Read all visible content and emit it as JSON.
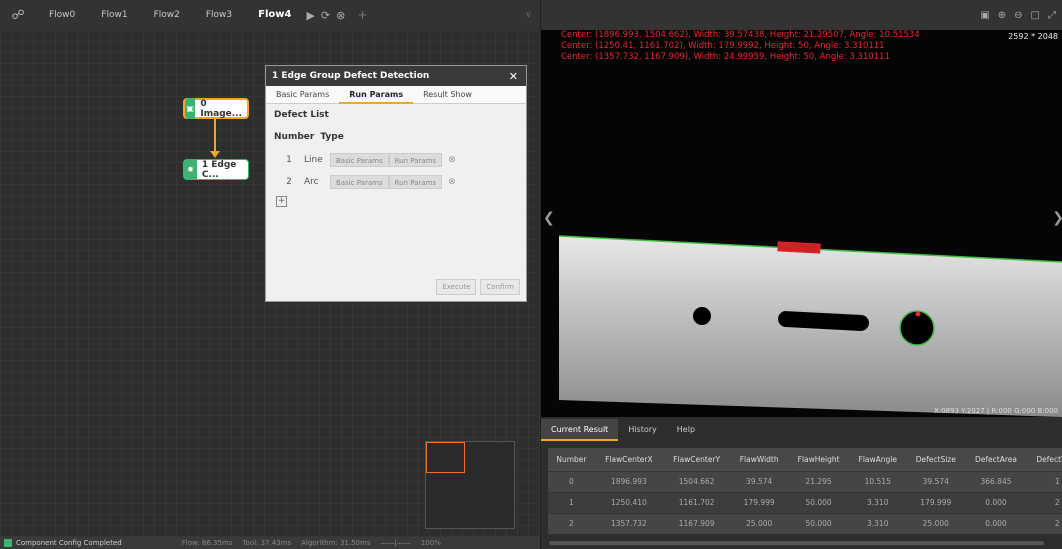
{
  "flow_tabs": [
    "Flow0",
    "Flow1",
    "Flow2",
    "Flow3",
    "Flow4"
  ],
  "active_flow": "Flow4",
  "nodes": [
    {
      "label": "0 Image..."
    },
    {
      "label": "1 Edge C..."
    }
  ],
  "dialog": {
    "title": "1  Edge Group Defect Detection",
    "tabs": [
      "Basic Params",
      "Run Params",
      "Result Show"
    ],
    "active_tab": "Run Params",
    "section": "Defect List",
    "col_number": "Number",
    "col_type": "Type",
    "rows": [
      {
        "num": "1",
        "type": "Line",
        "basic": "Basic Params",
        "run": "Run Params"
      },
      {
        "num": "2",
        "type": "Arc",
        "basic": "Basic Params",
        "run": "Run Params"
      }
    ],
    "execute": "Execute",
    "confirm": "Confirm"
  },
  "status": {
    "message": "Component Config Completed",
    "flow": "Flow: 86.35ms",
    "tool": "Tool: 37.43ms",
    "algorithm": "Algorithm: 31.50ms",
    "zoom": "100%"
  },
  "image_view": {
    "overlay_lines": [
      "Center: (1896.993, 1504.662), Width: 39.57438, Height: 21.29507, Angle: 10.51534",
      "Center: (1250.41, 1161.702), Width: 179.9992, Height: 50, Angle: 3.310111",
      "Center: (1357.732, 1167.909), Width: 24.99959, Height: 50, Angle: 3.310111"
    ],
    "dimensions": "2592 * 2048",
    "pixel_info": "X:0893 Y:2027 | R:000 G:000 B:000"
  },
  "result_tabs": [
    "Current Result",
    "History",
    "Help"
  ],
  "active_result_tab": "Current Result",
  "result_table": {
    "columns": [
      "Number",
      "FlawCenterX",
      "FlawCenterY",
      "FlawWidth",
      "FlawHeight",
      "FlawAngle",
      "DefectSize",
      "DefectArea",
      "DefectType"
    ],
    "rows": [
      [
        "0",
        "1896.993",
        "1504.662",
        "39.574",
        "21.295",
        "10.515",
        "39.574",
        "366.845",
        "1"
      ],
      [
        "1",
        "1250.410",
        "1161.702",
        "179.999",
        "50.000",
        "3.310",
        "179.999",
        "0.000",
        "2"
      ],
      [
        "2",
        "1357.732",
        "1167.909",
        "25.000",
        "50.000",
        "3.310",
        "25.000",
        "0.000",
        "2"
      ]
    ]
  },
  "colors": {
    "accent": "#f5a623",
    "node_green": "#3cb371",
    "overlay_red": "#e22233"
  }
}
